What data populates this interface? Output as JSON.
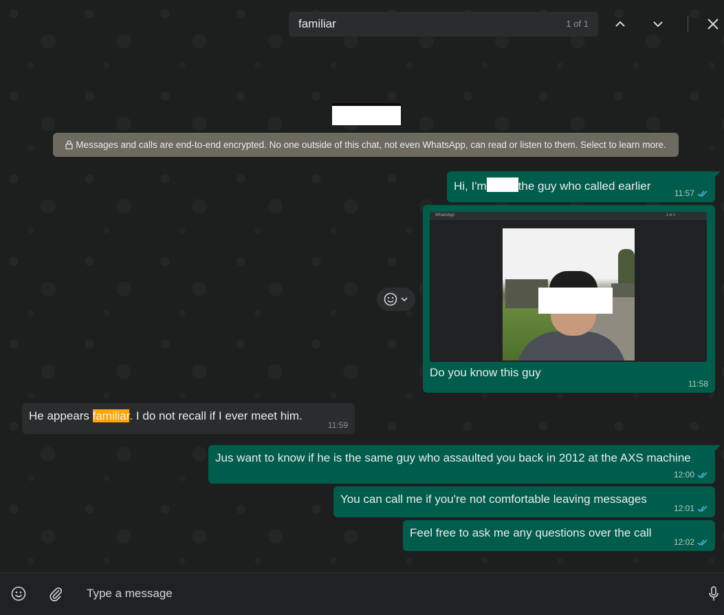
{
  "search": {
    "query": "familiar",
    "count": "1 of 1"
  },
  "encryption_notice": "Messages and calls are end-to-end encrypted. No one outside of this chat, not even WhatsApp, can read or listen to them. Select to learn more.",
  "messages": [
    {
      "pre": "Hi, I'm",
      "post": "the guy who called earlier",
      "time": "11:57"
    },
    {
      "image_window_title": "WhatsApp",
      "image_toolbar_text": "1 of 1",
      "caption": "Do you know this guy",
      "time": "11:58"
    },
    {
      "pre": "He appears ",
      "highlight": "familiar",
      "post": ". I do not recall if I ever meet him.",
      "time": "11:59"
    },
    {
      "text": "Jus want to know if he is the same guy who assaulted you back in 2012 at the AXS machine",
      "time": "12:00"
    },
    {
      "text": "You can call me if you're not comfortable leaving messages",
      "time": "12:01"
    },
    {
      "text": "Feel free to ask me any questions over the call",
      "time": "12:02"
    }
  ],
  "composer": {
    "placeholder": "Type a message"
  },
  "colors": {
    "outgoing_bubble": "#005c4b",
    "incoming_bubble": "#2a2c2d",
    "read_tick": "#53bdeb",
    "search_highlight": "#ffa500"
  }
}
